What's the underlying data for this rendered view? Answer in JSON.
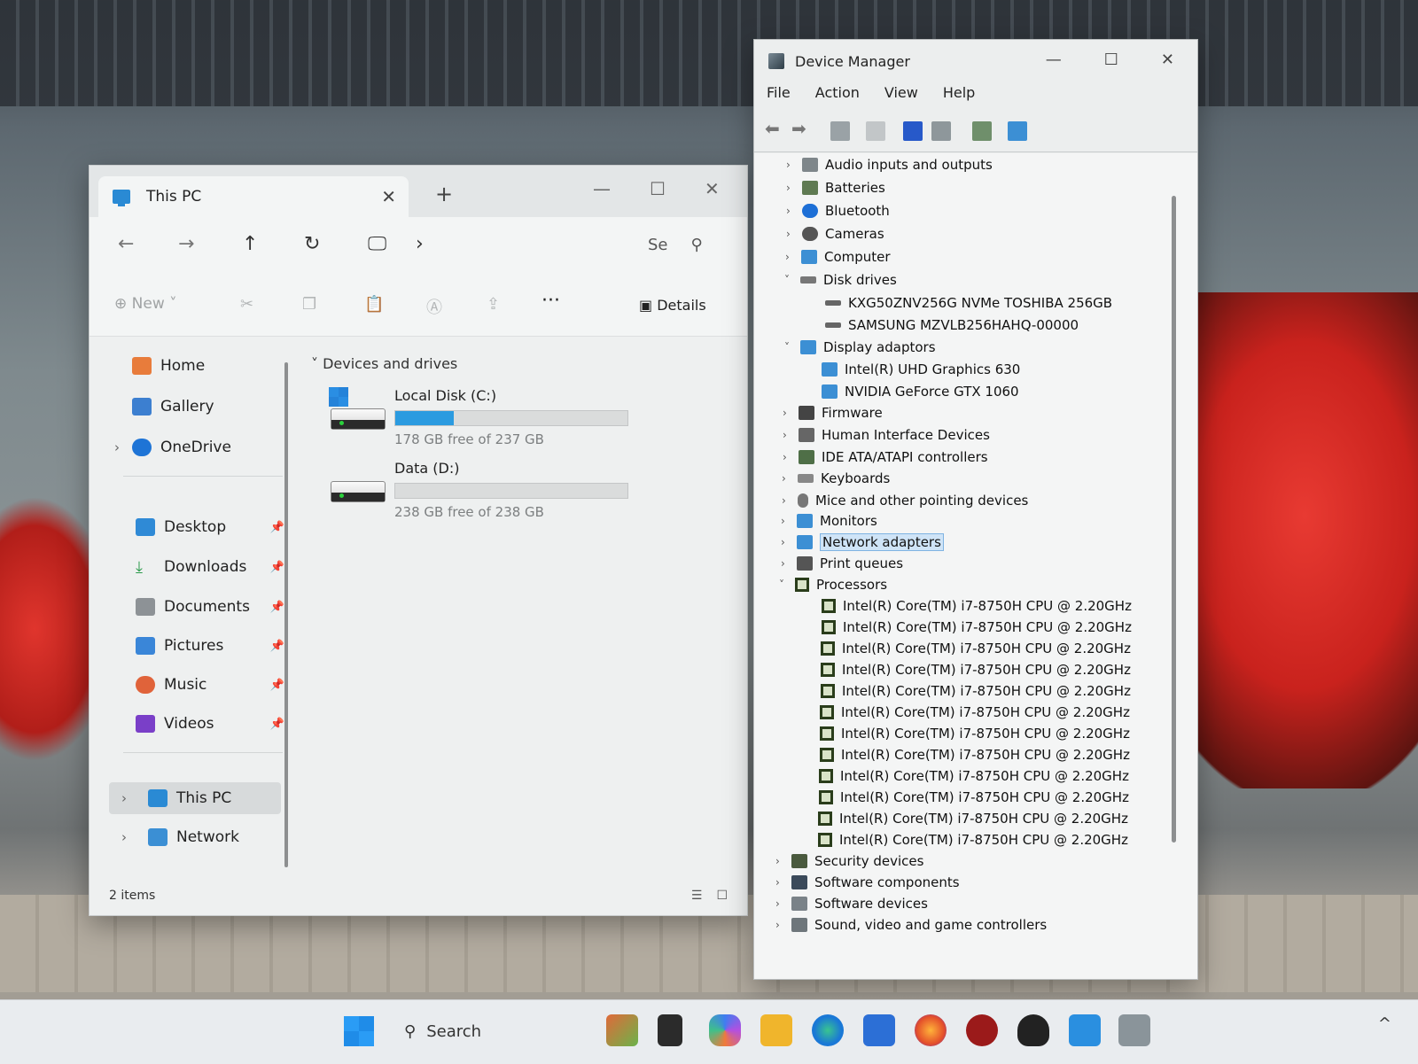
{
  "explorer": {
    "tab_title": "This PC",
    "tab_close": "✕",
    "new_tab": "+",
    "win_min": "—",
    "win_max": "☐",
    "win_close": "✕",
    "nav": {
      "back": "←",
      "forward": "→",
      "up": "↑",
      "refresh": "↻",
      "pc": "🖵",
      "chevron": "›"
    },
    "search_text": "Se",
    "toolbar": {
      "new_label": "New",
      "more": "···",
      "details_label": "Details"
    },
    "sidebar": {
      "home": "Home",
      "gallery": "Gallery",
      "onedrive": "OneDrive",
      "desktop": "Desktop",
      "downloads": "Downloads",
      "documents": "Documents",
      "pictures": "Pictures",
      "music": "Music",
      "videos": "Videos",
      "thispc": "This PC",
      "network": "Network"
    },
    "group_header": "Devices and drives",
    "drives": [
      {
        "name": "Local Disk (C:)",
        "free": "178 GB free of 237 GB",
        "used_fraction": 0.25
      },
      {
        "name": "Data (D:)",
        "free": "238 GB free of 238 GB",
        "used_fraction": 0.0
      }
    ],
    "status": "2 items"
  },
  "devmgr": {
    "title": "Device Manager",
    "menu": {
      "file": "File",
      "action": "Action",
      "view": "View",
      "help": "Help"
    },
    "tree": {
      "audio": "Audio inputs and outputs",
      "batteries": "Batteries",
      "bluetooth": "Bluetooth",
      "cameras": "Cameras",
      "computer": "Computer",
      "disk_drives": "Disk drives",
      "disk1": "KXG50ZNV256G NVMe TOSHIBA 256GB",
      "disk2": "SAMSUNG MZVLB256HAHQ-00000",
      "display": "Display adaptors",
      "gpu1": "Intel(R) UHD Graphics 630",
      "gpu2": "NVIDIA GeForce GTX 1060",
      "firmware": "Firmware",
      "hid": "Human Interface Devices",
      "ide": "IDE ATA/ATAPI controllers",
      "keyboards": "Keyboards",
      "mice": "Mice and other pointing devices",
      "monitors": "Monitors",
      "network": "Network adapters",
      "print": "Print queues",
      "processors": "Processors",
      "cpu": "Intel(R) Core(TM) i7-8750H CPU @ 2.20GHz",
      "security": "Security devices",
      "softcomp": "Software components",
      "softdev": "Software devices",
      "sound": "Sound, video and game controllers"
    }
  },
  "taskbar": {
    "search_label": "Search",
    "chevron": "^"
  }
}
